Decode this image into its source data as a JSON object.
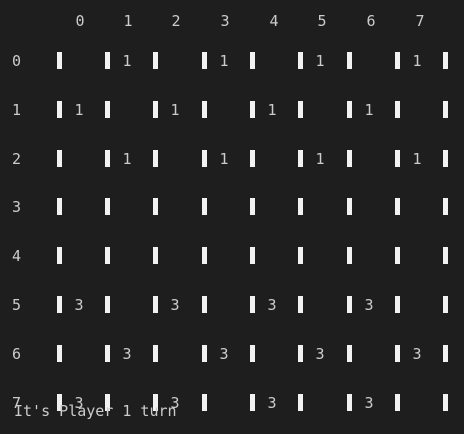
{
  "board": {
    "column_headers": [
      "0",
      "1",
      "2",
      "3",
      "4",
      "5",
      "6",
      "7"
    ],
    "rows": [
      {
        "label": "0",
        "cells": [
          "",
          "1",
          "",
          "1",
          "",
          "1",
          "",
          "1"
        ]
      },
      {
        "label": "1",
        "cells": [
          "1",
          "",
          "1",
          "",
          "1",
          "",
          "1",
          ""
        ]
      },
      {
        "label": "2",
        "cells": [
          "",
          "1",
          "",
          "1",
          "",
          "1",
          "",
          "1"
        ]
      },
      {
        "label": "3",
        "cells": [
          "",
          "",
          "",
          "",
          "",
          "",
          "",
          ""
        ]
      },
      {
        "label": "4",
        "cells": [
          "",
          "",
          "",
          "",
          "",
          "",
          "",
          ""
        ]
      },
      {
        "label": "5",
        "cells": [
          "3",
          "",
          "3",
          "",
          "3",
          "",
          "3",
          ""
        ]
      },
      {
        "label": "6",
        "cells": [
          "",
          "3",
          "",
          "3",
          "",
          "3",
          "",
          "3"
        ]
      },
      {
        "label": "7",
        "cells": [
          "3",
          "",
          "3",
          "",
          "3",
          "",
          "3",
          ""
        ]
      }
    ]
  },
  "status": "It's Player 1 turn",
  "colors": {
    "background": "#1e1e1e",
    "text": "#cccccc",
    "cell_divider": "#f2f2f2"
  }
}
